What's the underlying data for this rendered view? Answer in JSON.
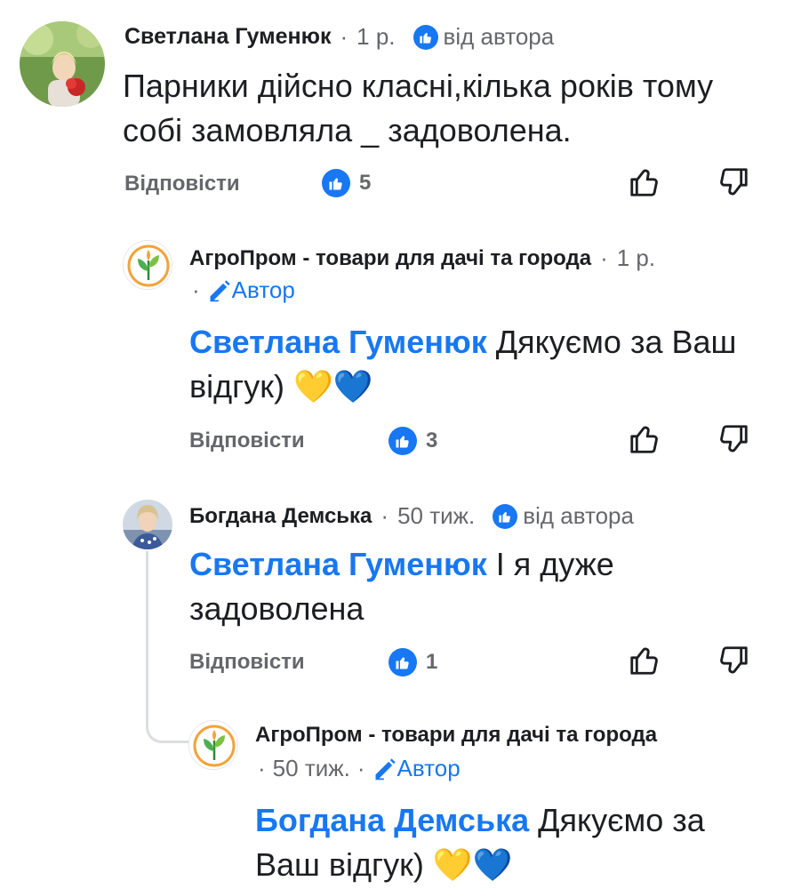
{
  "comments": [
    {
      "name": "Светлана Гуменюк",
      "time": "1 р.",
      "badge": "від автора",
      "text": "Парники дійсно класні,кілька років тому собі замовляла _ задоволена.",
      "reply_label": "Відповісти",
      "likes": "5"
    },
    {
      "name": "АгроПром - товари для дачі та города",
      "time": "1 р.",
      "author_label": "Автор",
      "mention": "Светлана Гуменюк",
      "text": "Дякуємо за Ваш відгук) 💛💙",
      "reply_label": "Відповісти",
      "likes": "3"
    },
    {
      "name": "Богдана Демська",
      "time": "50 тиж.",
      "badge": "від автора",
      "mention": "Светлана Гуменюк",
      "text": "І я дуже задоволена",
      "reply_label": "Відповісти",
      "likes": "1"
    },
    {
      "name": "АгроПром - товари для дачі та города",
      "time": "50 тиж.",
      "author_label": "Автор",
      "mention": "Богдана Демська",
      "text": "Дякуємо за Ваш відгук) 💛💙"
    }
  ],
  "separator": "·",
  "icons": {
    "like": "thumbs-up-icon",
    "dislike": "thumbs-down-icon",
    "badge": "like-badge-icon",
    "author": "pencil-icon"
  },
  "colors": {
    "accent": "#1877f2",
    "muted": "#65676b",
    "text": "#1c1e21"
  }
}
